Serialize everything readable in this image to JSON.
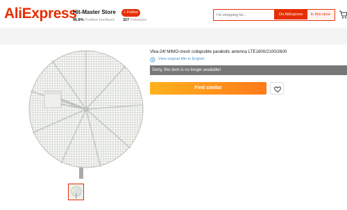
{
  "header": {
    "logo": "AliExpress",
    "store_name": "Hit-Master Store",
    "feedback_pct": "96.8%",
    "feedback_label": "Positive feedback",
    "follow_label": "+ Follow",
    "followers_count": "327",
    "followers_label": "Followers",
    "search": {
      "placeholder": "I'm shopping for...",
      "btn_aliexpress": "On AliExpress",
      "btn_store": "In this store"
    },
    "cart_icon": "cart-icon"
  },
  "product": {
    "title": "Vika-24f MIMO-mesh collapsible parabolic antenna LTE1800/2100/2600",
    "view_original": "View original title in English",
    "notice": "Sorry, this item is no longer available!",
    "find_similar": "Find similar",
    "wishlist_icon": "heart-icon",
    "image_icon": "parabolic-antenna-image"
  },
  "colors": {
    "brand": "#e62e04",
    "cta_start": "#ffb21c",
    "cta_end": "#ff7a1a",
    "notice_bg": "#777777",
    "link": "#4a90c4"
  }
}
